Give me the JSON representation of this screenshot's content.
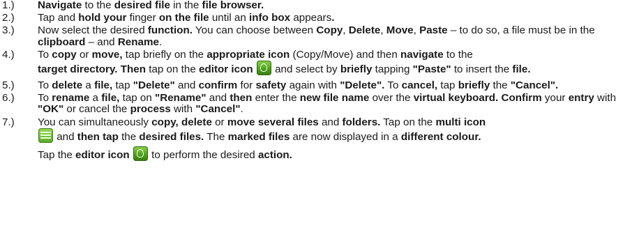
{
  "steps": [
    {
      "num": "1.)",
      "t1": "Navigate",
      "t2": " to the ",
      "t3": "desired file",
      "t4": " in the ",
      "t5": "file browser."
    },
    {
      "num": "2.)",
      "t1": "Tap and ",
      "t2": "hold your",
      "t3": " finger ",
      "t4": "on the file",
      "t5": " until an ",
      "t6": "info box",
      "t7": " appears",
      "t8": "."
    },
    {
      "num": "3.)",
      "t1": "Now select the desired ",
      "t2": "function.",
      "t3": " You can choose between ",
      "t4": "Copy",
      "t5": ", ",
      "t6": "Delete",
      "t7": ", ",
      "t8": "Move",
      "t9": ", ",
      "t10": "Paste",
      "t11": " – to do so, a file must be in the ",
      "t12": "clipboard",
      "t13": " – and ",
      "t14": "Rename",
      "t15": "."
    },
    {
      "num": "4.)",
      "t1": "To ",
      "t2": "copy",
      "t3": " or ",
      "t4": "move,",
      "t5": " tap briefly on the ",
      "t6": "appropriate icon",
      "t7": " (Copy/Move) and then ",
      "t8": "navigate",
      "t9": " to the",
      "t10": "target directory. Then",
      "t11": " tap on the ",
      "t12": "editor icon",
      "t13": " and select by ",
      "t14": "briefly",
      "t15": " tapping ",
      "t16": "\"Paste\"",
      "t17": " to insert the ",
      "t18": "file."
    },
    {
      "num": "5.)",
      "t1": "To ",
      "t2": "delete",
      "t3": " a ",
      "t4": "file,",
      "t5": " tap ",
      "t6": "\"Delete\"",
      "t7": " and ",
      "t8": "confirm",
      "t9": " for ",
      "t10": "safety",
      "t11": " again with ",
      "t12": "\"Delete\".",
      "t13": " To ",
      "t14": "cancel,",
      "t15": " tap ",
      "t16": "briefly",
      "t17": " the ",
      "t18": "\"Cancel\"."
    },
    {
      "num": "6.)",
      "t1": "To ",
      "t2": "rename",
      "t3": " a ",
      "t4": "file,",
      "t5": " tap on ",
      "t6": "\"Rename\"",
      "t7": " and ",
      "t8": "then",
      "t9": " enter the ",
      "t10": "new file name",
      "t11": " over the ",
      "t12": "virtual keyboard. Confirm",
      "t13": " your ",
      "t14": "entry",
      "t15": " with ",
      "t16": "\"OK\"",
      "t17": " or cancel the ",
      "t18": "process",
      "t19": " with ",
      "t20": "\"Cancel\"",
      "t21": "."
    },
    {
      "num": "7.)",
      "t1": "You can simultaneously ",
      "t2": "copy, delete",
      "t3": " or ",
      "t4": "move several files",
      "t5": " and ",
      "t6": "folders.",
      "t7": " Tap on the ",
      "t8": "multi icon",
      "t9": " and ",
      "t10": "then tap",
      "t11": " the ",
      "t12": "desired files.",
      "t13": " The ",
      "t14": "marked files",
      "t15": " are now displayed in a ",
      "t16": "different colour.",
      "t17": "Tap the ",
      "t18": "editor icon",
      "t19": " to perform the desired ",
      "t20": "action."
    }
  ],
  "icons": {
    "editor": "editor-icon",
    "multi": "multi-icon",
    "accent": "#4fa21c"
  }
}
